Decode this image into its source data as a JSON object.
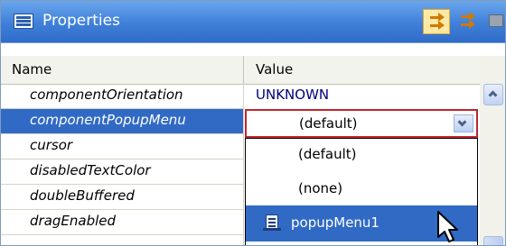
{
  "titlebar": {
    "title": "Properties",
    "icon": "properties-list-icon",
    "buttons": [
      {
        "name": "categorized-view-button",
        "icon": "arrows-icon",
        "active": true
      },
      {
        "name": "alphabetical-view-button",
        "icon": "arrows-icon",
        "active": false
      },
      {
        "name": "grid-view-button",
        "icon": "grid-icon",
        "active": false
      }
    ]
  },
  "table": {
    "headers": {
      "name": "Name",
      "value": "Value"
    },
    "rows": [
      {
        "name": "componentOrientation",
        "value": "UNKNOWN"
      },
      {
        "name": "componentPopupMenu",
        "value": "(default)",
        "selected": true
      },
      {
        "name": "cursor"
      },
      {
        "name": "disabledTextColor"
      },
      {
        "name": "doubleBuffered"
      },
      {
        "name": "dragEnabled",
        "value": "false"
      }
    ]
  },
  "dropdown": {
    "options": [
      "(default)",
      "(none)",
      "popupMenu1"
    ],
    "highlighted": "popupMenu1"
  },
  "colors": {
    "titlebar": "#3f7fd9",
    "selection": "#316ac5",
    "combo_border": "#c0262c",
    "enum_value": "#00007a"
  }
}
